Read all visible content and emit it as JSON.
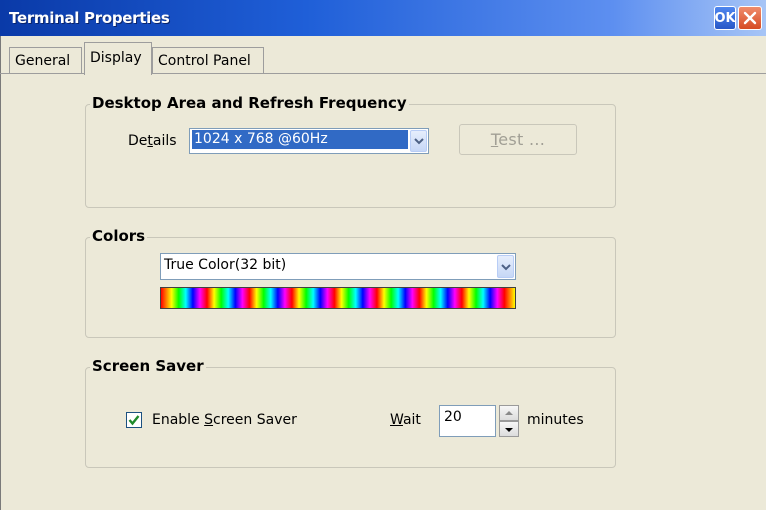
{
  "window": {
    "title": "Terminal Properties",
    "ok_label": "OK",
    "close_icon": "close-icon",
    "colors": {
      "titlebar": "#0a3aa8",
      "selection": "#316ac5",
      "check": "#1f8a2a",
      "close": "#d64b24"
    }
  },
  "tabs": [
    {
      "label": "General",
      "active": false
    },
    {
      "label": "Display",
      "active": true
    },
    {
      "label": "Control Panel",
      "active": false
    }
  ],
  "desktop_area": {
    "legend": "Desktop Area and Refresh Frequency",
    "details_label_pre": "De",
    "details_label_key": "t",
    "details_label_post": "ails",
    "resolution_value": "1024 x 768 @60Hz",
    "test_button_key": "T",
    "test_button_rest": "est ...",
    "test_enabled": false
  },
  "colors_group": {
    "legend": "Colors",
    "color_depth_value": "True Color(32 bit)"
  },
  "screen_saver": {
    "legend": "Screen Saver",
    "enable_checked": true,
    "enable_label_pre": "Enable ",
    "enable_label_key": "S",
    "enable_label_post": "creen Saver",
    "wait_label_key": "W",
    "wait_label_post": "ait",
    "wait_value": "20",
    "minutes_label": "minutes"
  }
}
